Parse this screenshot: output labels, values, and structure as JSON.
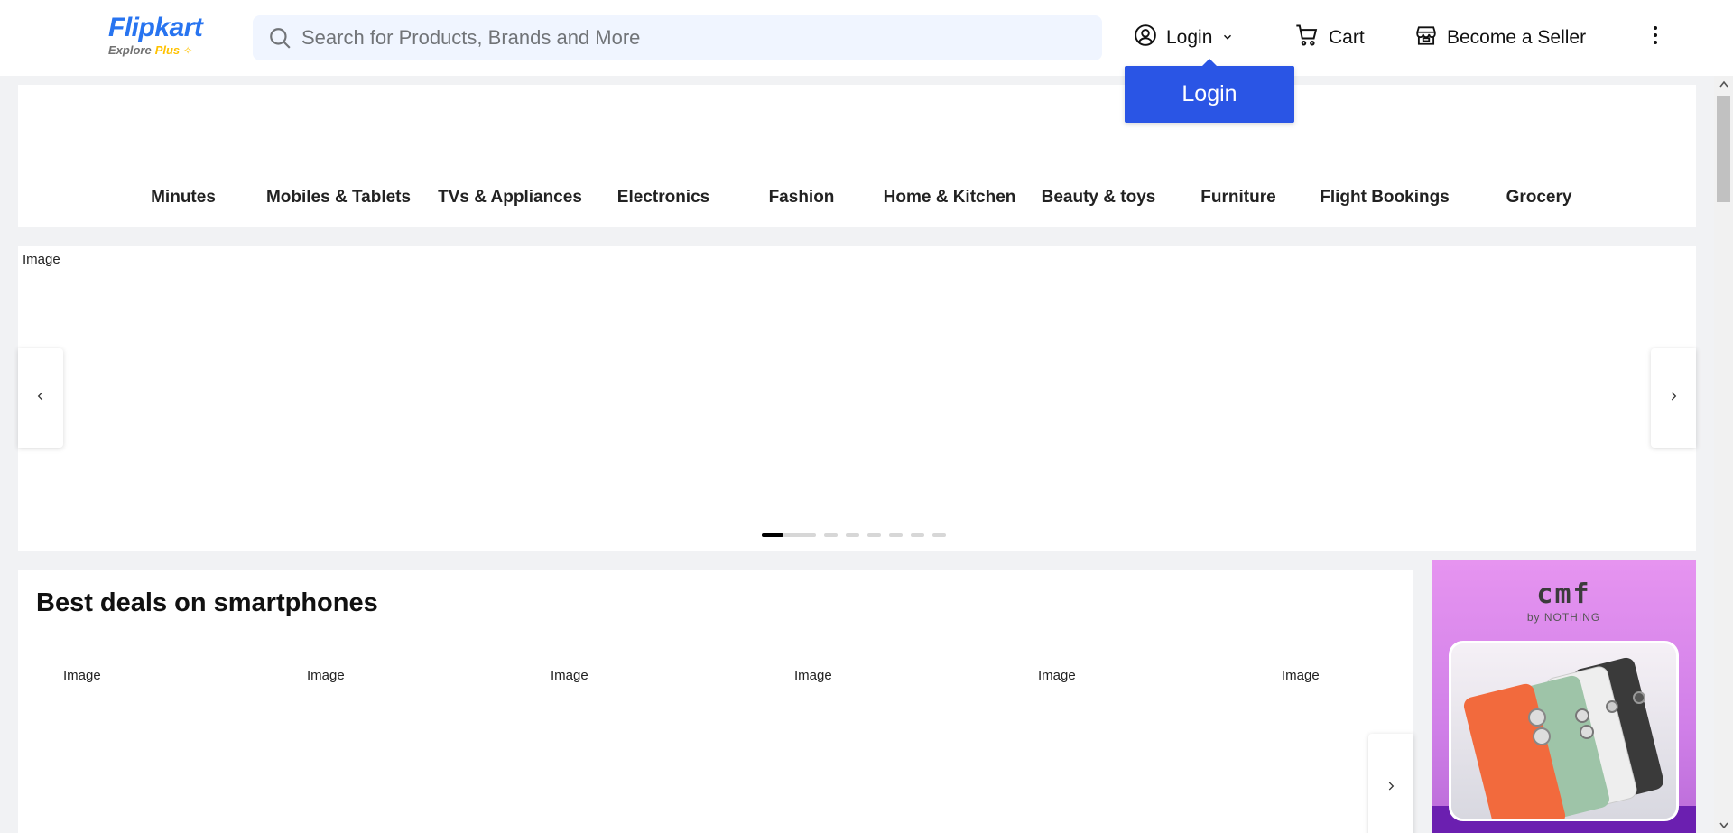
{
  "header": {
    "logo": {
      "brand": "Flipkart",
      "tagline_explore": "Explore",
      "tagline_plus": "Plus"
    },
    "search": {
      "placeholder": "Search for Products, Brands and More",
      "value": ""
    },
    "login_label": "Login",
    "cart_label": "Cart",
    "seller_label": "Become a Seller"
  },
  "login_dropdown": {
    "label": "Login"
  },
  "categories": [
    "Minutes",
    "Mobiles & Tablets",
    "TVs & Appliances",
    "Electronics",
    "Fashion",
    "Home & Kitchen",
    "Beauty & toys",
    "Furniture",
    "Flight Bookings",
    "Grocery"
  ],
  "banner": {
    "image_alt": "Image",
    "slide_count": 8,
    "active_slide": 1
  },
  "deals": {
    "title": "Best deals on smartphones",
    "items": [
      "Image",
      "Image",
      "Image",
      "Image",
      "Image",
      "Image"
    ]
  },
  "ad": {
    "brand": "cmf",
    "sub": "by NOTHING"
  },
  "colors": {
    "accent": "#2874f0",
    "login_dropdown_bg": "#2a55e5",
    "search_bg": "#f0f5ff",
    "page_bg": "#f1f2f4"
  }
}
